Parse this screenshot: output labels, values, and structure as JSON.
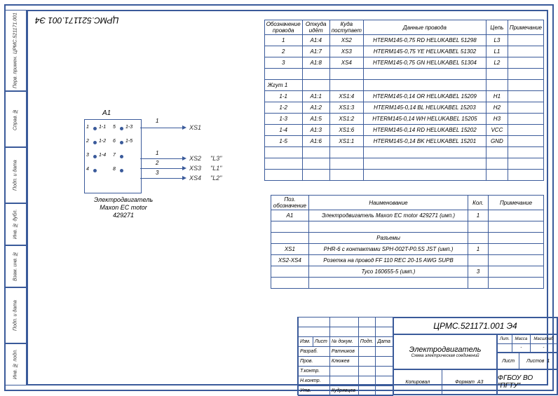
{
  "doc_number": "ЦРМС.521171.001 Э4",
  "doc_number_rot": "ЦРМС.521171.001 Э4",
  "title_main": "Электродвигатель",
  "title_sub": "Схема электрическая соединений",
  "org": "ФГБОУ ВО \"ПГТУ\"",
  "motor_ref": "А1",
  "motor_caption": "Электродвигатель\nMaxon EC motor\n429271",
  "wire_hdr": {
    "c1": "Обозначение провода",
    "c2": "Откуда идёт",
    "c3": "Куда поступает",
    "c4": "Данные провода",
    "c5": "Цепь",
    "c6": "Примечание"
  },
  "wires": [
    {
      "n": "1",
      "from": "А1:4",
      "to": "XS2",
      "data": "HTERM145-0,75 RD HELUKABEL 51298",
      "cir": "L3"
    },
    {
      "n": "2",
      "from": "А1:7",
      "to": "XS3",
      "data": "HTERM145-0,75 YE HELUKABEL 51302",
      "cir": "L1"
    },
    {
      "n": "3",
      "from": "А1:8",
      "to": "XS4",
      "data": "HTERM145-0,75 GN HELUKABEL 51304",
      "cir": "L2"
    }
  ],
  "bundle": "Жгут 1",
  "wires2": [
    {
      "n": "1-1",
      "from": "А1:1",
      "to": "XS1:4",
      "data": "HTERM145-0,14 OR HELUKABEL 15209",
      "cir": "H1"
    },
    {
      "n": "1-2",
      "from": "А1:2",
      "to": "XS1:3",
      "data": "HTERM145-0,14 BL HELUKABEL 15203",
      "cir": "H2"
    },
    {
      "n": "1-3",
      "from": "А1:5",
      "to": "XS1:2",
      "data": "HTERM145-0,14 WH HELUKABEL 15205",
      "cir": "H3"
    },
    {
      "n": "1-4",
      "from": "А1:3",
      "to": "XS1:6",
      "data": "HTERM145-0,14 RD HELUKABEL 15202",
      "cir": "VCC"
    },
    {
      "n": "1-5",
      "from": "А1:6",
      "to": "XS1:1",
      "data": "HTERM145-0,14 BK HELUKABEL 15201",
      "cir": "GND"
    }
  ],
  "parts_hdr": {
    "p1": "Поз. обозначение",
    "p2": "Наименование",
    "p3": "Кол.",
    "p4": "Примечание"
  },
  "parts": [
    {
      "ref": "А1",
      "name": "Электродвигатель Maxon EC motor 429271 (имп.)",
      "qty": "1"
    },
    {
      "ref": "",
      "name": "Разъемы",
      "qty": ""
    },
    {
      "ref": "XS1",
      "name": "PHR-6 с контактами SPH-002T-P0.5S JST (имп.)",
      "qty": "1"
    },
    {
      "ref": "XS2-XS4",
      "name": "Розетка на провод FF 110 REC 20-15 AWG SUPB",
      "qty": ""
    },
    {
      "ref": "",
      "name": "Tyco 160655-5 (имп.)",
      "qty": "3"
    }
  ],
  "sig": {
    "h1": "Изм.",
    "h2": "Лист",
    "h3": "№ докум.",
    "h4": "Подп.",
    "h5": "Дата",
    "r1": "Разраб.",
    "n1": "Ратников",
    "r2": "Пров.",
    "n2": "Клюжев",
    "r3": "Т.контр.",
    "r4": "Н.контр.",
    "r5": "Утв.",
    "n5": "Кудрявцев"
  },
  "lit": {
    "l": "Лит.",
    "m": "Масса",
    "s": "Масштаб"
  },
  "sheet": {
    "l": "Лист",
    "t": "Листов",
    "tn": "1"
  },
  "kopir": "Копировал",
  "fmt": "Формат",
  "fmtv": "А3",
  "left": {
    "b1": "Инв. № подл.",
    "b2": "Подп. и дата",
    "b3": "Взам. инв. №",
    "b4": "Инв. № дубл.",
    "b5": "Подп. и дата",
    "b6": "Справ. №",
    "b7": "Перв. примен.",
    "b7v": "ЦРМС.521171.001"
  },
  "xs": {
    "xs1": "XS1",
    "xs2": "XS2",
    "xs3": "XS3",
    "xs4": "XS4",
    "l3": "\"L3\"",
    "l1": "\"L1\"",
    "l2": "\"L2\""
  },
  "pins": [
    "1",
    "2",
    "3",
    "4",
    "5",
    "6",
    "7",
    "8"
  ],
  "wnum": {
    "w1": "1",
    "w2": "1",
    "w3": "2",
    "w4": "3"
  },
  "pinrow": [
    "1-1",
    "1-2",
    "1-4",
    "1-3",
    "1-5"
  ]
}
